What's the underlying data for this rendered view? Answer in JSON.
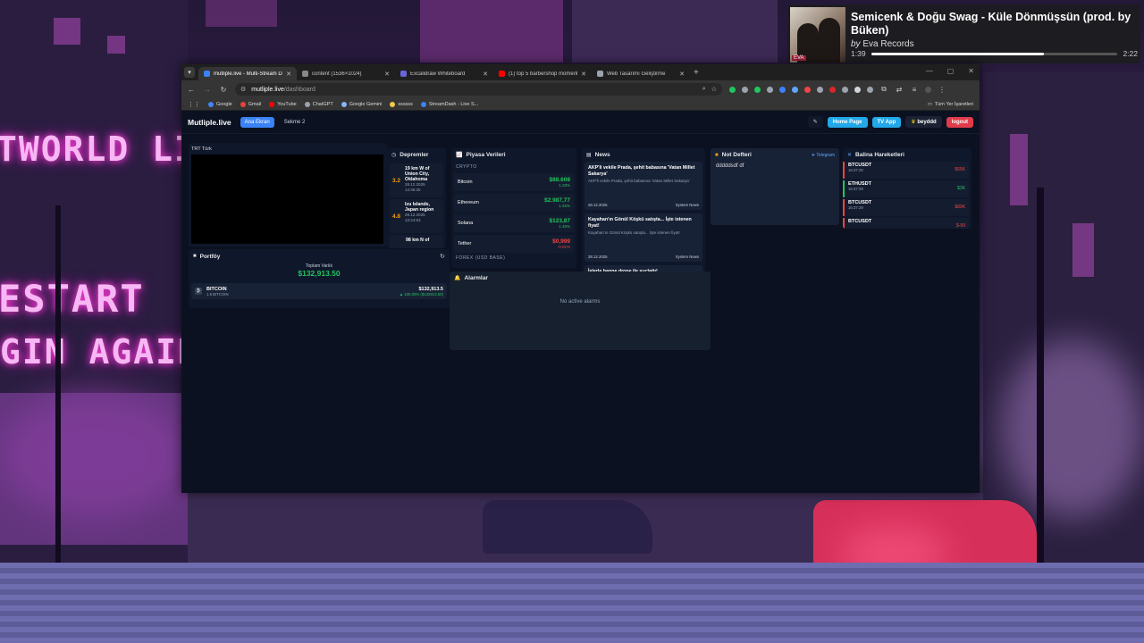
{
  "music": {
    "title": "Semicenk & Doğu Swag - Küle Dönmüşsün (prod. by Büken)",
    "by": "by",
    "artist": "Eva Records",
    "elapsed": "1:39",
    "total": "2:22",
    "progress": 0.7
  },
  "wallpaper": {
    "neon_top": "TWORLD LI",
    "neon_mid": "ESTART",
    "neon_bottom": "GIN AGAIN"
  },
  "browser": {
    "tabs": [
      {
        "label": "mutliple.live - Multi-Stream Da",
        "color": "#3b82f6",
        "active": true
      },
      {
        "label": "content (1536×1024)",
        "color": "#888888",
        "active": false
      },
      {
        "label": "Excalidraw Whiteboard",
        "color": "#6965db",
        "active": false
      },
      {
        "label": "(1) top 5 barbershop momente",
        "color": "#ff0000",
        "active": false
      },
      {
        "label": "Web Tasarımı Geliştirme",
        "color": "#9ca3af",
        "active": false
      }
    ],
    "new_tab": "+",
    "url_host": "mutliple.live",
    "url_path": "/dashboard",
    "bookmarks": [
      {
        "label": "Google",
        "color": "#4285f4"
      },
      {
        "label": "Gmail",
        "color": "#ea4335"
      },
      {
        "label": "YouTube",
        "color": "#ff0000"
      },
      {
        "label": "ChatGPT",
        "color": "#9ca3af"
      },
      {
        "label": "Google Gemini",
        "color": "#8ab4f8"
      },
      {
        "label": "ssssss",
        "color": "#f2c94c"
      },
      {
        "label": "StreamDash - Live S...",
        "color": "#3b82f6"
      }
    ],
    "all_bookmarks": "Tüm Yer İşaretleri"
  },
  "app": {
    "logo": "Mutliple.live",
    "tabs": [
      "Ana Ekran",
      "Sekme 2"
    ],
    "buttons": {
      "home": "Home Page",
      "tv": "TV App",
      "user": "beyddd",
      "logout": "logout"
    },
    "tv": {
      "label": "TRT Türk"
    },
    "earthquakes": {
      "title": "Depremler",
      "items": [
        {
          "mag": "3.2",
          "place": "19 km W of Union City, Oklahoma",
          "date": "28.12.2025",
          "time": "14:36:25"
        },
        {
          "mag": "4.8",
          "place": "Izu Islands, Japan region",
          "date": "28.12.2025",
          "time": "13:44:53"
        },
        {
          "mag": "",
          "place": "98 km N of",
          "date": "",
          "time": ""
        }
      ]
    },
    "market": {
      "title": "Piyasa Verileri",
      "crypto_label": "CRYPTO",
      "forex_label": "FOREX (USD BASE)",
      "rows": [
        {
          "name": "Bitcoin",
          "price": "$88.608",
          "change": "1.28%",
          "dir": "up"
        },
        {
          "name": "Ethereum",
          "price": "$2.987,77",
          "change": "1.45%",
          "dir": "up"
        },
        {
          "name": "Solana",
          "price": "$123,87",
          "change": "1.48%",
          "dir": "up"
        },
        {
          "name": "Tether",
          "price": "$0,999",
          "change": "-0.01%",
          "dir": "down"
        }
      ]
    },
    "news": {
      "title": "News",
      "items": [
        {
          "headline": "AKP'li vekile Prada, şehit babasına 'Vatan Millet Sakarya'",
          "summary": "AKP'li vekile Prada, şehit babasına 'Vatan Millet Sakarya'",
          "date": "28.12.2025",
          "source": "System News"
        },
        {
          "headline": "Kayahan'ın Gönül Köşkü satışta... İşte istenen fiyat!",
          "summary": "Kayahan'ın Gönül Köşkü satışta... İşte istenen fiyat!",
          "date": "28.12.2025",
          "source": "System News"
        },
        {
          "headline": "İşlerle hanne drone ile suçlattı!",
          "summary": "",
          "date": "",
          "source": ""
        }
      ]
    },
    "notes": {
      "title": "Not Defteri",
      "telegram": "Telegram",
      "content": "dddddsdf df"
    },
    "whales": {
      "title": "Balina Hareketleri",
      "rows": [
        {
          "symbol": "BTCUSDT",
          "time": "16:37:29",
          "amount": "$65K",
          "dir": "down"
        },
        {
          "symbol": "ETHUSDT",
          "time": "16:37:29",
          "amount": "$3K",
          "dir": "up"
        },
        {
          "symbol": "BTCUSDT",
          "time": "16:37:29",
          "amount": "$89K",
          "dir": "down"
        },
        {
          "symbol": "BTCUSDT",
          "time": "",
          "amount": "$-99",
          "dir": "down"
        }
      ]
    },
    "portfolio": {
      "title": "Portföy",
      "total_label": "Toplam Varlık",
      "total": "$132,913.50",
      "items": [
        {
          "name": "BITCOIN",
          "qty": "1.5 BITCOIN",
          "value": "$132,913.5",
          "change": "▲ 100.00% ($132913.50)"
        }
      ]
    },
    "alarms": {
      "title": "Alarmlar",
      "empty": "No active alarms"
    }
  }
}
